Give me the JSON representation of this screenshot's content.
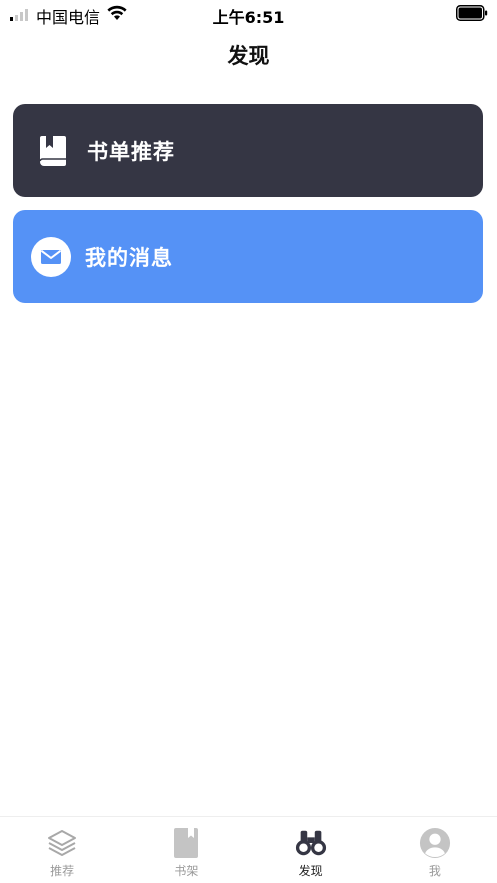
{
  "status_bar": {
    "carrier": "中国电信",
    "time": "上午6:51",
    "icons": [
      "signal-icon",
      "wifi-icon",
      "battery-icon"
    ]
  },
  "nav": {
    "title": "发现"
  },
  "cards": [
    {
      "label": "书单推荐",
      "icon": "book-icon",
      "color": "#353644"
    },
    {
      "label": "我的消息",
      "icon": "mail-icon",
      "color": "#5592F6"
    }
  ],
  "tab_bar": {
    "active": "发现",
    "tabs": [
      {
        "label": "推荐",
        "icon": "layers-icon"
      },
      {
        "label": "书架",
        "icon": "bookshelf-icon"
      },
      {
        "label": "发现",
        "icon": "binoculars-icon"
      },
      {
        "label": "我",
        "icon": "user-icon"
      }
    ]
  },
  "colors": {
    "inactive_tab": "#9a9a9a",
    "active_tab": "#222222"
  }
}
